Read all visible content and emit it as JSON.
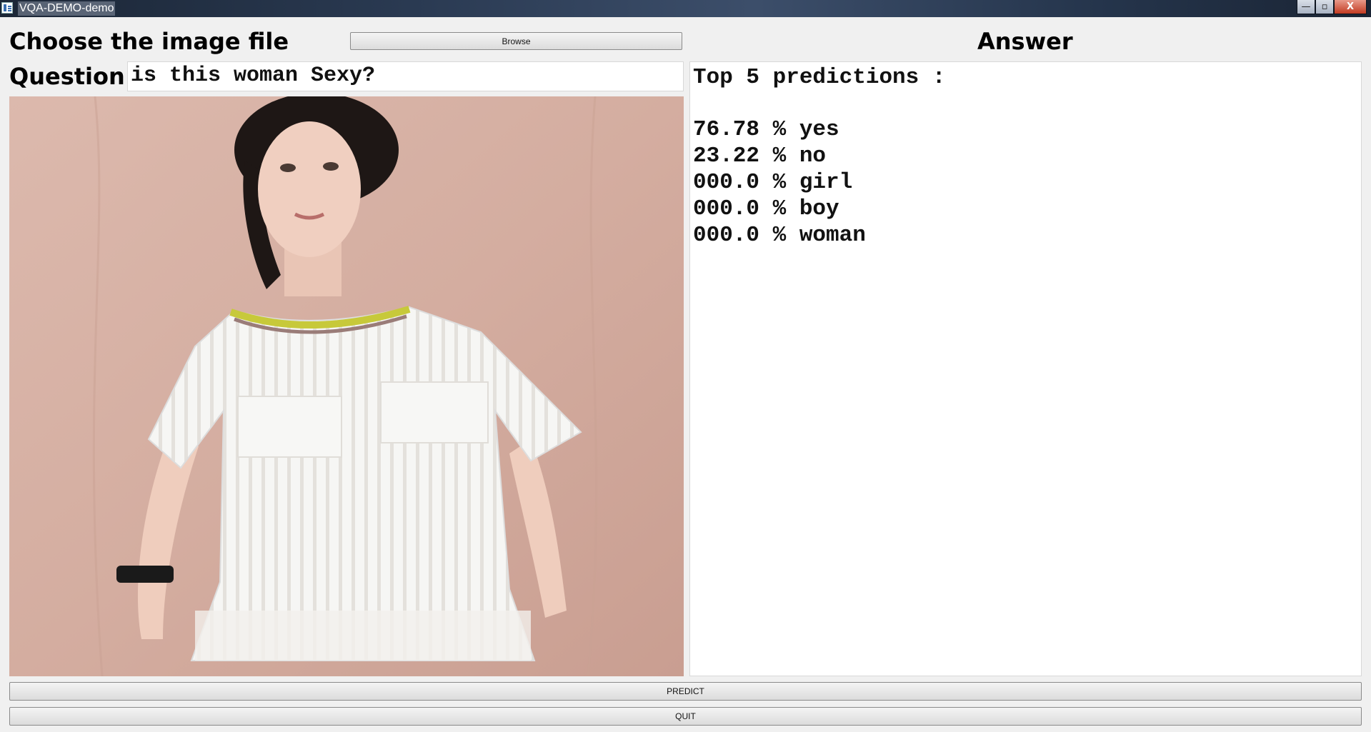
{
  "window": {
    "title": "VQA-DEMO-demo",
    "controls": {
      "minimize": "—",
      "maximize": "▫",
      "close": "X"
    }
  },
  "left": {
    "choose_label": "Choose the image file",
    "browse_label": "Browse",
    "question_label": "Question",
    "question_value": "is this woman Sexy?"
  },
  "answer": {
    "heading": "Answer",
    "header_line": "Top 5 predictions :",
    "predictions": [
      {
        "score": "76.78",
        "label": "yes"
      },
      {
        "score": "23.22",
        "label": "no"
      },
      {
        "score": "000.0",
        "label": "girl"
      },
      {
        "score": "000.0",
        "label": "boy"
      },
      {
        "score": "000.0",
        "label": "woman"
      }
    ]
  },
  "buttons": {
    "predict": "PREDICT",
    "quit": "QUIT"
  }
}
